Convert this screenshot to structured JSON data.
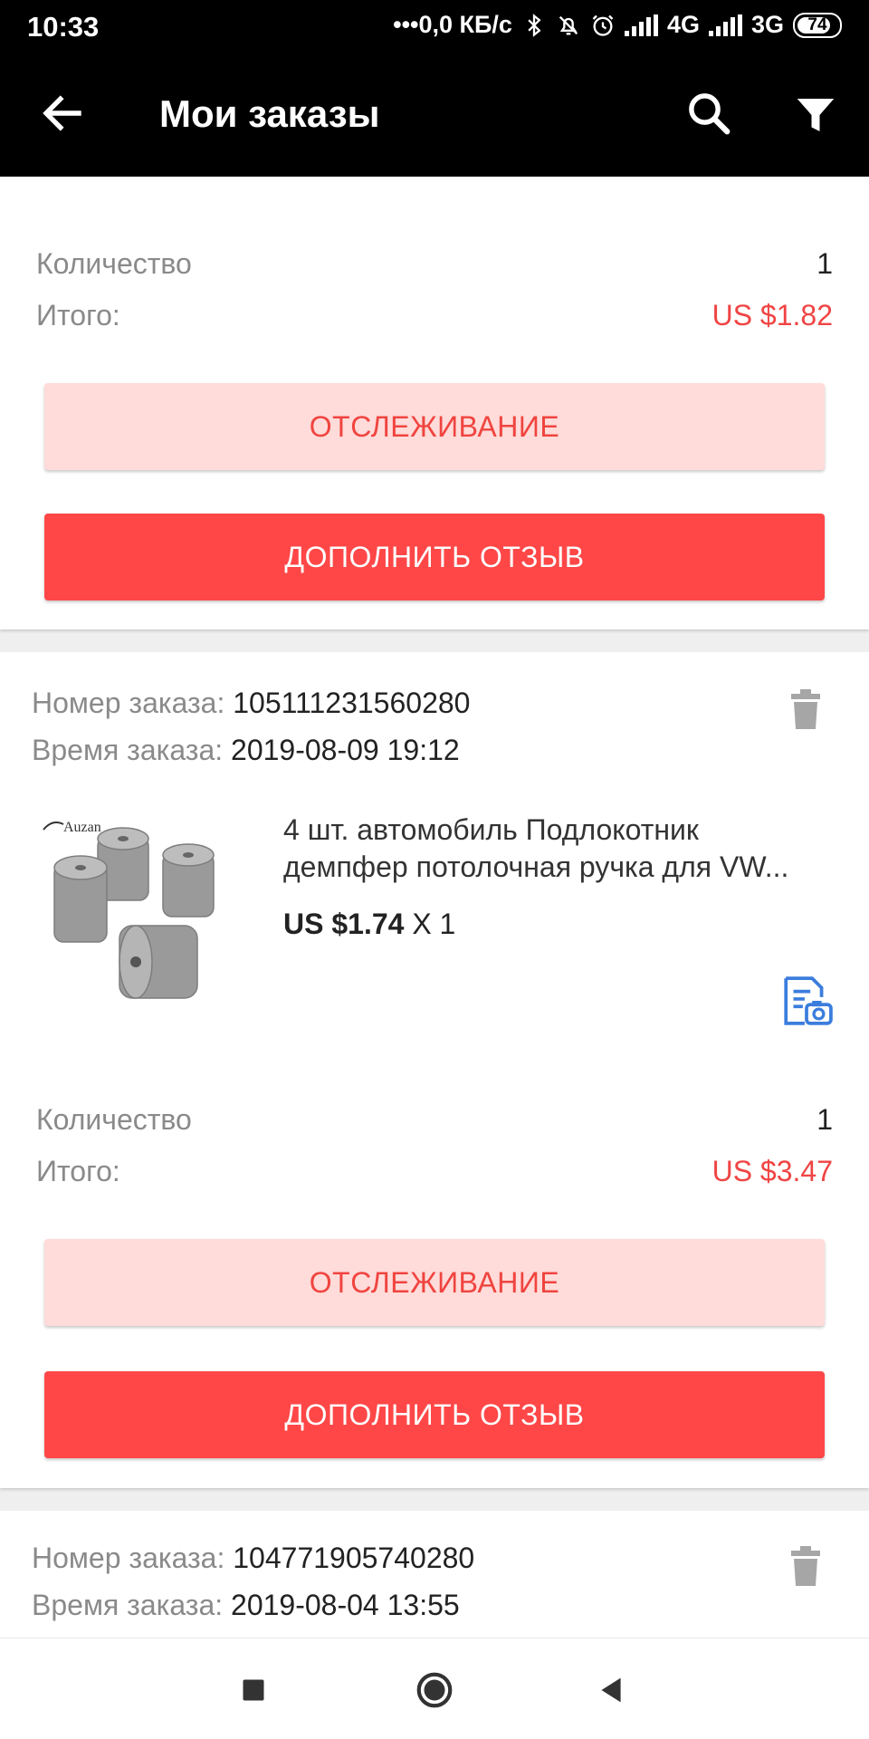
{
  "status_bar": {
    "time": "10:33",
    "speed": "•••0,0 КБ/с",
    "net1": "4G",
    "net2": "3G",
    "battery": "74"
  },
  "app_bar": {
    "title": "Мои заказы",
    "back_icon": "arrow-left-icon",
    "search_icon": "search-icon",
    "filter_icon": "filter-icon"
  },
  "orders": [
    {
      "quantity_label": "Количество",
      "quantity": "1",
      "total_label": "Итого:",
      "total": "US $1.82",
      "track_label": "ОТСЛЕЖИВАНИЕ",
      "review_label": "ДОПОЛНИТЬ ОТЗЫВ"
    },
    {
      "order_no_label": "Номер заказа:",
      "order_no": "105111231560280",
      "order_time_label": "Время заказа:",
      "order_time": "2019-08-09 19:12",
      "product": {
        "brand": "Auzan",
        "title_line1": "4 шт. автомобиль Подлокотник",
        "title_line2": "демпфер потолочная ручка для VW...",
        "price": "US $1.74",
        "qty": "X 1"
      },
      "quantity_label": "Количество",
      "quantity": "1",
      "total_label": "Итого:",
      "total": "US $3.47",
      "track_label": "ОТСЛЕЖИВАНИЕ",
      "review_label": "ДОПОЛНИТЬ ОТЗЫВ"
    },
    {
      "order_no_label": "Номер заказа:",
      "order_no": "104771905740280",
      "order_time_label": "Время заказа:",
      "order_time": "2019-08-04 13:55"
    }
  ],
  "colors": {
    "accent": "#ff4747",
    "accent_light": "#ffdbd9",
    "price_red": "#f04444",
    "snapshot_blue": "#3b7ddd"
  },
  "nav_bar": {
    "recents_icon": "square-icon",
    "home_icon": "circle-icon",
    "back_icon": "triangle-back-icon"
  }
}
